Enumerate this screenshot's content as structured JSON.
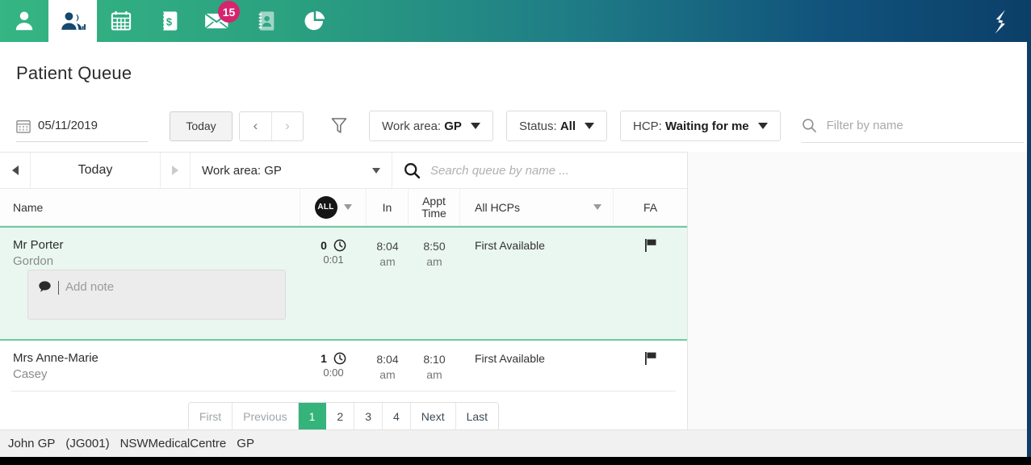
{
  "topnav": {
    "items": [
      {
        "name": "patient-icon",
        "label": "Patient",
        "active": false
      },
      {
        "name": "patient-queue-icon",
        "label": "Patient Queue",
        "active": true
      },
      {
        "name": "calendar-icon",
        "label": "Appointments",
        "active": false
      },
      {
        "name": "billing-icon",
        "label": "Billing",
        "active": false
      },
      {
        "name": "messages-icon",
        "label": "Messages",
        "active": false,
        "badge": "15"
      },
      {
        "name": "contacts-icon",
        "label": "Contacts",
        "active": false
      },
      {
        "name": "reports-icon",
        "label": "Reports",
        "active": false
      }
    ],
    "badge_count": "15",
    "badge_color": "#d6246e",
    "brand_logo": "app-logo",
    "gradient_from": "#35b583",
    "gradient_to": "#0b3f68"
  },
  "page": {
    "title": "Patient Queue"
  },
  "filterbar": {
    "date_value": "05/11/2019",
    "date_icon": "calendar-icon",
    "today_label": "Today",
    "prev_label": "‹",
    "next_label": "›",
    "funnel_icon": "filter-funnel-icon",
    "work_area_prefix": "Work area:",
    "work_area_value": "GP",
    "status_prefix": "Status:",
    "status_value": "All",
    "hcp_prefix": "HCP:",
    "hcp_value": "Waiting for me",
    "search_icon": "search-icon",
    "search_placeholder": "Filter by name",
    "search_value": ""
  },
  "queue_toolbar": {
    "prev_icon": "triangle-left-icon",
    "today_label": "Today",
    "next_icon": "triangle-right-icon",
    "work_area_label": "Work area: GP",
    "search_icon": "search-icon",
    "search_placeholder": "Search queue by name ...",
    "search_value": ""
  },
  "table": {
    "headers": {
      "name": "Name",
      "all_chip": "ALL",
      "in": "In",
      "appt_line1": "Appt",
      "appt_line2": "Time",
      "hcp": "All HCPs",
      "fa": "FA"
    },
    "rows": [
      {
        "title_line": "Mr Porter",
        "sub_line": "Gordon",
        "count": "0",
        "elapsed": "0:01",
        "in_time": "8:04",
        "in_ampm": "am",
        "appt_time": "8:50",
        "appt_ampm": "am",
        "hcp": "First Available",
        "flag_icon": "flag-icon",
        "clock_icon": "clock-icon",
        "selected": true,
        "note": {
          "icon": "comment-bubble-icon",
          "placeholder": "Add note",
          "value": ""
        }
      },
      {
        "title_line": "Mrs Anne-Marie",
        "sub_line": "Casey",
        "count": "1",
        "elapsed": "0:00",
        "in_time": "8:04",
        "in_ampm": "am",
        "appt_time": "8:10",
        "appt_ampm": "am",
        "hcp": "First Available",
        "flag_icon": "flag-icon",
        "clock_icon": "clock-icon",
        "selected": false
      }
    ]
  },
  "pagination": {
    "first": "First",
    "previous": "Previous",
    "pages": [
      "1",
      "2",
      "3",
      "4"
    ],
    "active_page": "1",
    "next": "Next",
    "last": "Last",
    "active_color": "#34b37a"
  },
  "footer": {
    "user_name": "John GP",
    "user_code": "(JG001)",
    "clinic": "NSWMedicalCentre",
    "role": "GP"
  }
}
